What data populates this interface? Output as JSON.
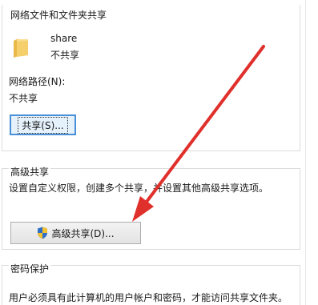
{
  "sections": {
    "network_sharing": {
      "title": "网络文件和文件夹共享",
      "folder_name": "share",
      "folder_status": "不共享",
      "path_label": "网络路径(N):",
      "path_value": "不共享",
      "share_button_label": "共享(S)..."
    },
    "advanced_sharing": {
      "title": "高级共享",
      "description": "设置自定义权限，创建多个共享，并设置其他高级共享选项。",
      "button_label": "高级共享(D)..."
    },
    "password_protection": {
      "title": "密码保护",
      "description": "用户必须具有此计算机的用户帐户和密码，才能访问共享文件夹。"
    }
  },
  "icons": {
    "folder": "folder-icon",
    "shield": "uac-shield-icon",
    "annotation": "red-arrow"
  },
  "colors": {
    "arrow": "#e0302b",
    "focus_border": "#4a90d9",
    "folder": "#f5cf6b"
  }
}
